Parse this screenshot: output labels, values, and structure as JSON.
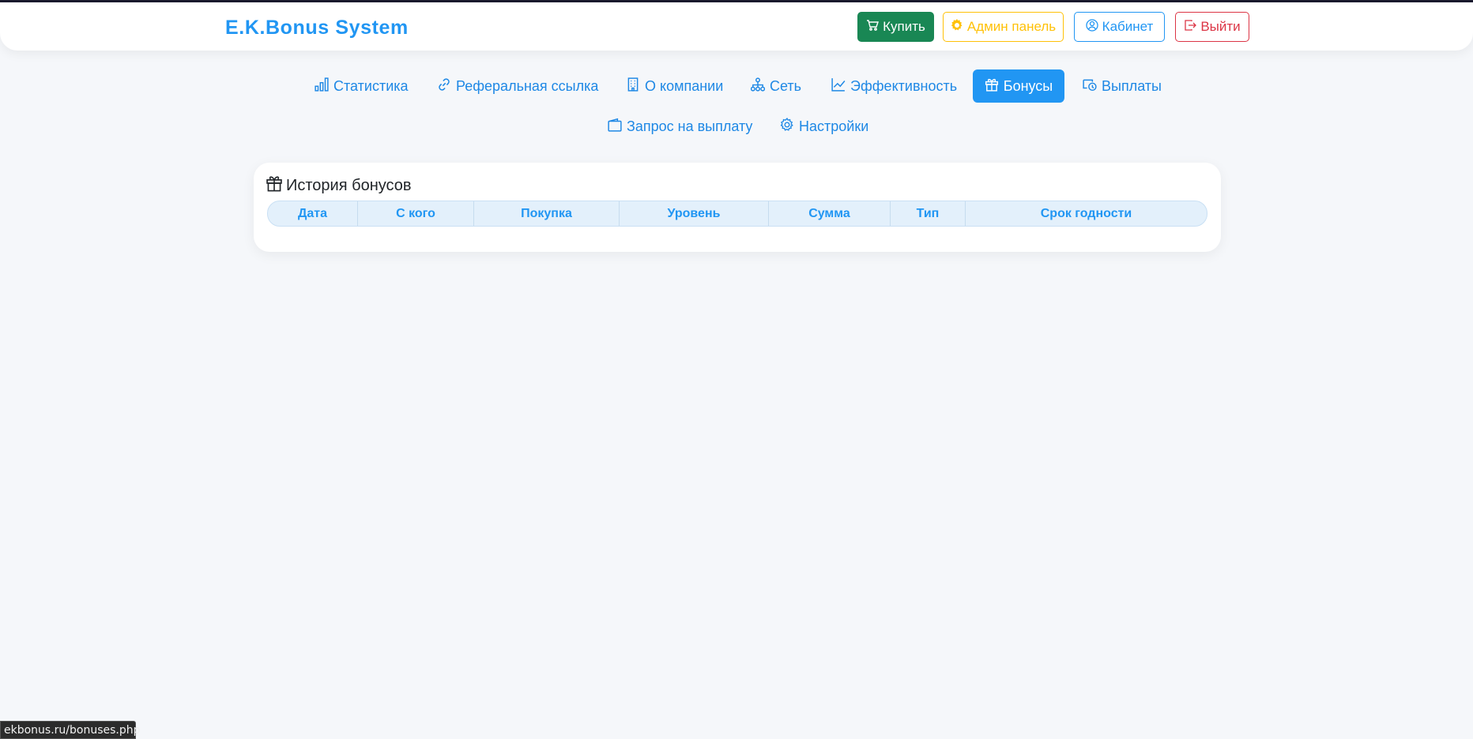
{
  "header": {
    "brand": "E.K.Bonus System",
    "buttons": {
      "buy": "Купить",
      "admin": "Админ панель",
      "cabinet": "Кабинет",
      "logout": "Выйти"
    }
  },
  "nav": {
    "items": [
      {
        "label": "Статистика",
        "icon": "bar-chart-icon"
      },
      {
        "label": "Реферальная ссылка",
        "icon": "link-icon"
      },
      {
        "label": "О компании",
        "icon": "building-icon"
      },
      {
        "label": "Сеть",
        "icon": "network-icon"
      },
      {
        "label": "Эффективность",
        "icon": "line-chart-icon"
      },
      {
        "label": "Бонусы",
        "icon": "gift-icon",
        "active": true
      },
      {
        "label": "Выплаты",
        "icon": "cash-icon"
      },
      {
        "label": "Запрос на выплату",
        "icon": "wallet-icon"
      },
      {
        "label": "Настройки",
        "icon": "gear-icon"
      }
    ]
  },
  "bonuses": {
    "title": "История бонусов",
    "columns": [
      "Дата",
      "С кого",
      "Покупка",
      "Уровень",
      "Сумма",
      "Тип",
      "Срок годности"
    ],
    "rows": []
  },
  "status_bar": {
    "url": "ekbonus.ru/bonuses.php"
  },
  "colors": {
    "accent": "#2196f3",
    "buy": "#198754",
    "admin": "#ffc107",
    "logout": "#dc3545",
    "background": "#f5f7fa"
  }
}
